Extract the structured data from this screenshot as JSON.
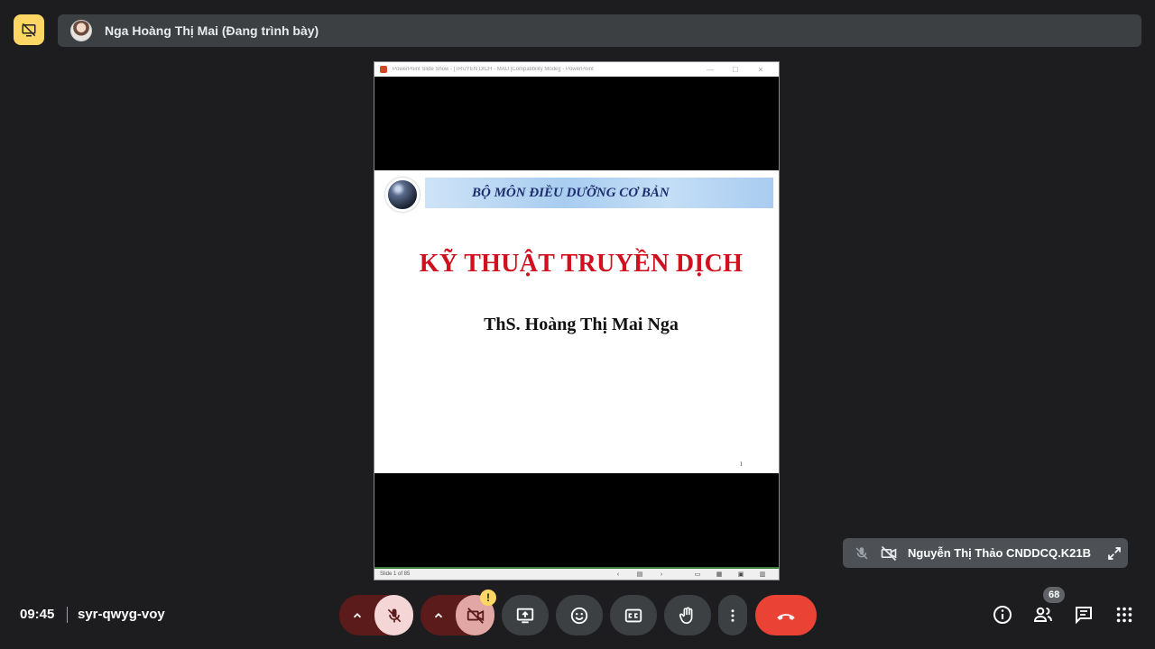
{
  "header": {
    "presenter_name": "Nga Hoàng Thị Mai (Đang trình bày)",
    "present_icon": "no-screen-share-icon"
  },
  "ppt_window": {
    "title": "PowerPoint Slide Show - [TRUYEN DICH - MAU [Compatibility Mode]] - PowerPoint",
    "status_left": "Slide 1 of 85"
  },
  "slide": {
    "header_text": "BỘ MÔN ĐIỀU DƯỠNG CƠ BẢN",
    "title": "KỸ THUẬT TRUYỀN DỊCH",
    "author": "ThS. Hoàng Thị Mai Nga",
    "number": "1"
  },
  "self_tile": {
    "name": "Nguyễn Thị Thảo CNDDCQ.K21B"
  },
  "meeting": {
    "time": "09:45",
    "code": "syr-qwyg-voy"
  },
  "controls": {
    "warning_badge": "!",
    "people_count": "68"
  },
  "colors": {
    "accent_yellow": "#fdd663",
    "leave_red": "#ea4335",
    "slide_title_red": "#d0101e"
  }
}
